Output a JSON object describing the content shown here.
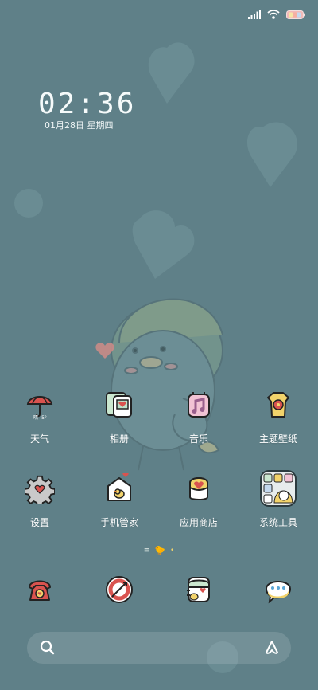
{
  "clock": {
    "time": "02:36",
    "date": "01月28日 星期四"
  },
  "status": {
    "signal": "signal-icon",
    "wifi": "wifi-icon",
    "battery": "battery-icon"
  },
  "apps": [
    {
      "label": "天气",
      "icon": "weather-icon"
    },
    {
      "label": "相册",
      "icon": "gallery-icon"
    },
    {
      "label": "音乐",
      "icon": "music-icon"
    },
    {
      "label": "主题壁纸",
      "icon": "themes-icon"
    },
    {
      "label": "设置",
      "icon": "settings-icon"
    },
    {
      "label": "手机管家",
      "icon": "security-icon"
    },
    {
      "label": "应用商店",
      "icon": "app-store-icon"
    },
    {
      "label": "系统工具",
      "icon": "system-tools-folder-icon"
    }
  ],
  "pager": {
    "dot": "≡",
    "current": "🐤",
    "other": "•"
  },
  "dock": [
    {
      "icon": "phone-icon"
    },
    {
      "icon": "browser-icon"
    },
    {
      "icon": "contacts-icon"
    },
    {
      "icon": "messages-icon"
    }
  ],
  "search": {
    "left_icon": "search-icon",
    "right_icon": "assistant-icon"
  },
  "colors": {
    "background": "#5f8088",
    "accent": "#f2d36b",
    "text": "#ffffff"
  }
}
